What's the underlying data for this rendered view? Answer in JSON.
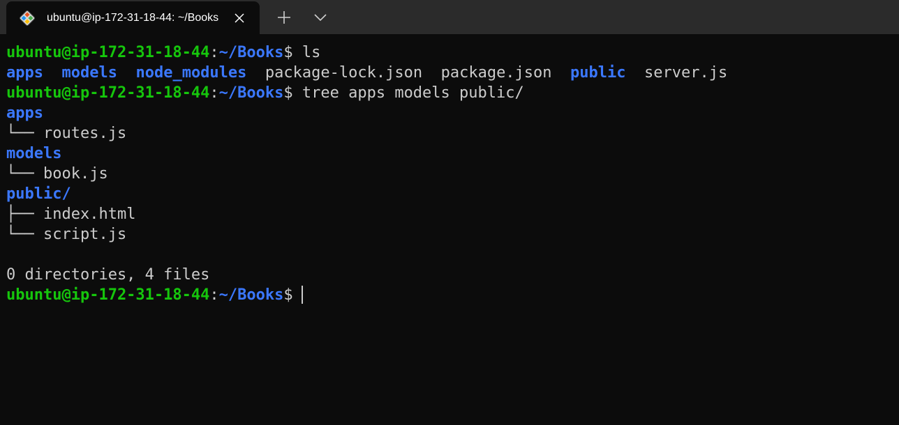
{
  "tab": {
    "title": "ubuntu@ip-172-31-18-44: ~/Books",
    "icon": "linux-penguin-icon"
  },
  "colors": {
    "prompt_user": "#16c60c",
    "prompt_path": "#3b78ff",
    "text": "#cccccc",
    "directory": "#3b78ff",
    "background": "#0c0c0c",
    "titlebar": "#2b2b2b"
  },
  "terminal": {
    "prompt_user": "ubuntu@ip-172-31-18-44",
    "prompt_sep": ":",
    "prompt_path": "~/Books",
    "prompt_dollar": "$",
    "cmd1": " ls",
    "ls_output": [
      {
        "name": "apps",
        "type": "dir"
      },
      {
        "name": "models",
        "type": "dir"
      },
      {
        "name": "node_modules",
        "type": "dir"
      },
      {
        "name": "package-lock.json",
        "type": "file"
      },
      {
        "name": "package.json",
        "type": "file"
      },
      {
        "name": "public",
        "type": "dir"
      },
      {
        "name": "server.js",
        "type": "file"
      }
    ],
    "cmd2": " tree apps models public/",
    "tree": {
      "apps": "apps",
      "apps_child": "routes.js",
      "models": "models",
      "models_child": "book.js",
      "public": "public/",
      "public_child1": "index.html",
      "public_child2": "script.js",
      "branch_last": "└── ",
      "branch_mid": "├── "
    },
    "summary": "0 directories, 4 files"
  }
}
